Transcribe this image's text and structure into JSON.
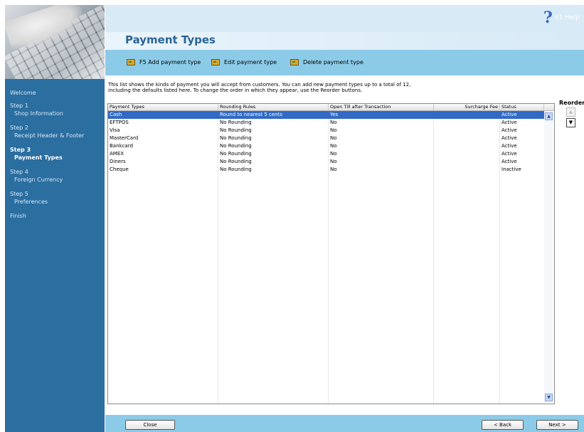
{
  "help": {
    "icon": "question-mark-icon",
    "label": "F1 Help"
  },
  "page_title": "Payment Types",
  "toolbar": {
    "add": "F5 Add payment type",
    "edit": "Edit payment type",
    "delete": "Delete payment type"
  },
  "sidebar": {
    "items": [
      {
        "head": "Welcome",
        "sub": ""
      },
      {
        "head": "Step 1",
        "sub": "Shop Information"
      },
      {
        "head": "Step 2",
        "sub": "Receipt Header & Footer"
      },
      {
        "head": "Step 3",
        "sub": "Payment Types"
      },
      {
        "head": "Step 4",
        "sub": "Foreign Currency"
      },
      {
        "head": "Step 5",
        "sub": "Preferences"
      },
      {
        "head": "Finish",
        "sub": ""
      }
    ]
  },
  "intro": {
    "line1": "This list shows the kinds of payment you will accept from customers.  You can add new payment types up to a total of 12,",
    "line2": "including the defaults listed here.  To change the order in which they appear, use the Reorder buttons."
  },
  "reorder": {
    "label": "Reorder"
  },
  "table": {
    "columns": [
      "Payment Types",
      "Rounding Rules",
      "Open Till after Transaction",
      "Surcharge Fee",
      "Status"
    ],
    "rows": [
      [
        "Cash",
        "Round to nearest 5 cents",
        "Yes",
        "",
        "Active"
      ],
      [
        "EFTPOS",
        "No Rounding",
        "No",
        "",
        "Active"
      ],
      [
        "Visa",
        "No Rounding",
        "No",
        "",
        "Active"
      ],
      [
        "MasterCard",
        "No Rounding",
        "No",
        "",
        "Active"
      ],
      [
        "Bankcard",
        "No Rounding",
        "No",
        "",
        "Active"
      ],
      [
        "AMEX",
        "No Rounding",
        "No",
        "",
        "Active"
      ],
      [
        "Diners",
        "No Rounding",
        "No",
        "",
        "Active"
      ],
      [
        "Cheque",
        "No Rounding",
        "No",
        "",
        "Inactive"
      ]
    ]
  },
  "footer": {
    "close": "Close",
    "back": "< Back",
    "next": "Next >"
  },
  "colors": {
    "sidebar": "#2b6ea0",
    "toolbar": "#8ccbe8",
    "title": "#2a6496",
    "selection": "#316ac5"
  }
}
